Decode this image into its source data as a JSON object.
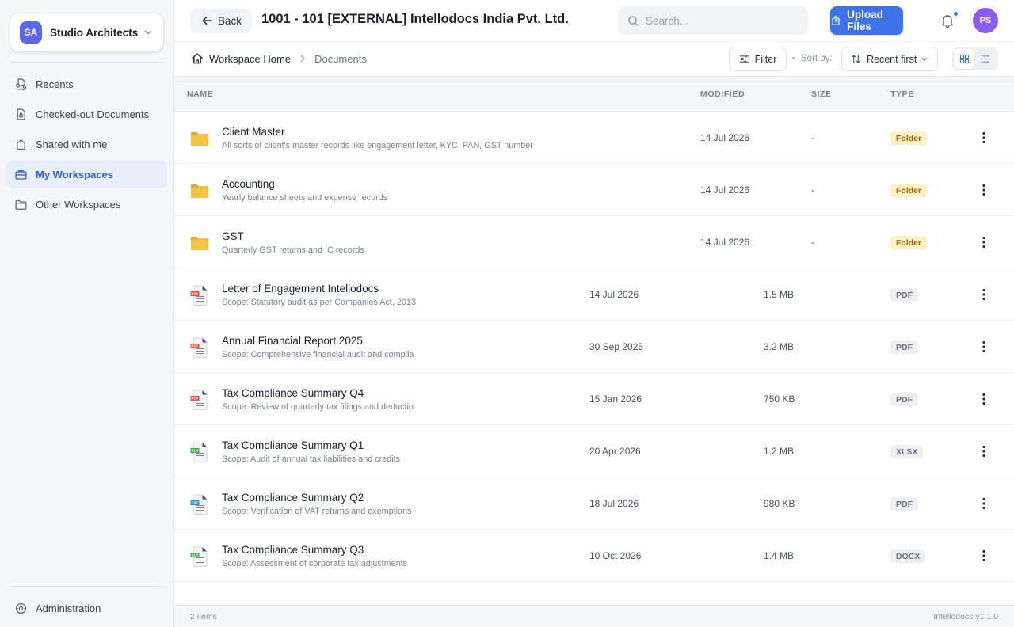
{
  "org": {
    "initials": "SA",
    "name": "Studio Architects"
  },
  "nav": [
    {
      "label": "Recents",
      "icon": "recents-icon"
    },
    {
      "label": "Checked-out Documents",
      "icon": "checked-out-document-icon"
    },
    {
      "label": "Shared with me",
      "icon": "shared-icon"
    },
    {
      "label": "My Workspaces",
      "icon": "briefcase-icon",
      "active": true
    },
    {
      "label": "Other Workspaces",
      "icon": "folder-icon"
    }
  ],
  "admin": {
    "label": "Administration"
  },
  "header": {
    "back_label": "Back",
    "title": "1001 - 101 [EXTERNAL] Intellodocs India Pvt. Ltd.",
    "search_placeholder": "Search...",
    "upload_label": "Upload Files",
    "user_initials": "PS"
  },
  "breadcrumb": {
    "home": "Workspace Home",
    "current": "Documents"
  },
  "toolbar": {
    "filter_label": "Filter",
    "sort_label": "Sort by:",
    "sort_value": "Recent first"
  },
  "columns": {
    "name": "NAME",
    "modified": "MODIFIED",
    "size": "SIZE",
    "type": "TYPE"
  },
  "rows": [
    {
      "kind": "folder",
      "name": "Client Master",
      "desc": "All sorts of client's master records like engagement letter, KYC, PAN, GST number",
      "modified": "14 Jul 2026",
      "size": "-",
      "type": "Folder"
    },
    {
      "kind": "folder",
      "name": "Accounting",
      "desc": "Yearly balance sheets and expense records",
      "modified": "14 Jul 2026",
      "size": "-",
      "type": "Folder"
    },
    {
      "kind": "folder",
      "name": "GST",
      "desc": "Quarterly GST returns and IC records",
      "modified": "14 Jul 2026",
      "size": "-",
      "type": "Folder"
    },
    {
      "kind": "file",
      "tag": "PDF",
      "tag_color": "#e0483e",
      "name": "Letter of Engagement Intellodocs",
      "desc": "Scope: Statutory audit as per Companies Act, 2013",
      "modified": "14 Jul 2026",
      "size": "1.5 MB",
      "type": "PDF"
    },
    {
      "kind": "file",
      "tag": "PDF",
      "tag_color": "#e0483e",
      "name": "Annual Financial Report 2025",
      "desc": "Scope: Comprehensive financial audit and complia",
      "modified": "30 Sep 2025",
      "size": "3.2 MB",
      "type": "PDF"
    },
    {
      "kind": "file",
      "tag": "PDF",
      "tag_color": "#e0483e",
      "name": "Tax Compliance Summary Q4",
      "desc": "Scope: Review of quarterly tax filings and deductio",
      "modified": "15 Jan 2026",
      "size": "750 KB",
      "type": "PDF"
    },
    {
      "kind": "file",
      "tag": "XLS",
      "tag_color": "#3aa845",
      "name": "Tax Compliance Summary Q1",
      "desc": "Scope: Audit of annual tax liabilities and credits",
      "modified": "20 Apr 2026",
      "size": "1.2 MB",
      "type": "XLSX"
    },
    {
      "kind": "file",
      "tag": "TXT",
      "tag_color": "#2a8fd6",
      "name": "Tax Compliance Summary Q2",
      "desc": "Scope: Verification of VAT returns and exemptions",
      "modified": "18 Jul 2026",
      "size": "980 KB",
      "type": "PDF"
    },
    {
      "kind": "file",
      "tag": "XLS",
      "tag_color": "#3aa845",
      "name": "Tax Compliance Summary Q3",
      "desc": "Scope: Assessment of corporate tax adjustments",
      "modified": "10 Oct 2026",
      "size": "1.4 MB",
      "type": "DOCX"
    }
  ],
  "footer": {
    "count": "2 items",
    "version": "Intellodocs v1.1.0"
  },
  "colors": {
    "accent": "#3d72e8",
    "folder": "#f2bd2c",
    "avatar_org": "#5b67e8",
    "avatar_user": "#8a5cf0"
  }
}
